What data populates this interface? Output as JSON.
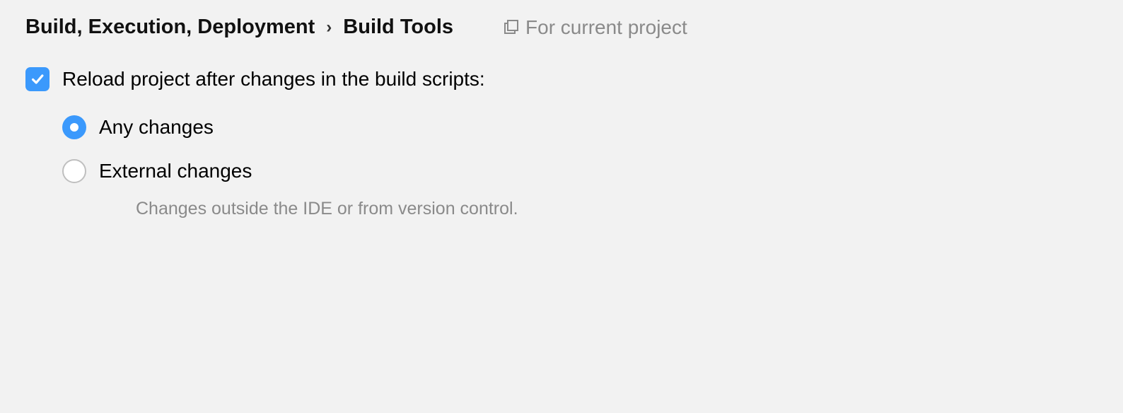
{
  "breadcrumb": {
    "parent": "Build, Execution, Deployment",
    "separator": "›",
    "current": "Build Tools"
  },
  "scope": {
    "label": "For current project"
  },
  "reload_option": {
    "label": "Reload project after changes in the build scripts:",
    "checked": true
  },
  "radio_options": {
    "any": {
      "label": "Any changes",
      "selected": true
    },
    "external": {
      "label": "External changes",
      "selected": false,
      "description": "Changes outside the IDE or from version control."
    }
  }
}
